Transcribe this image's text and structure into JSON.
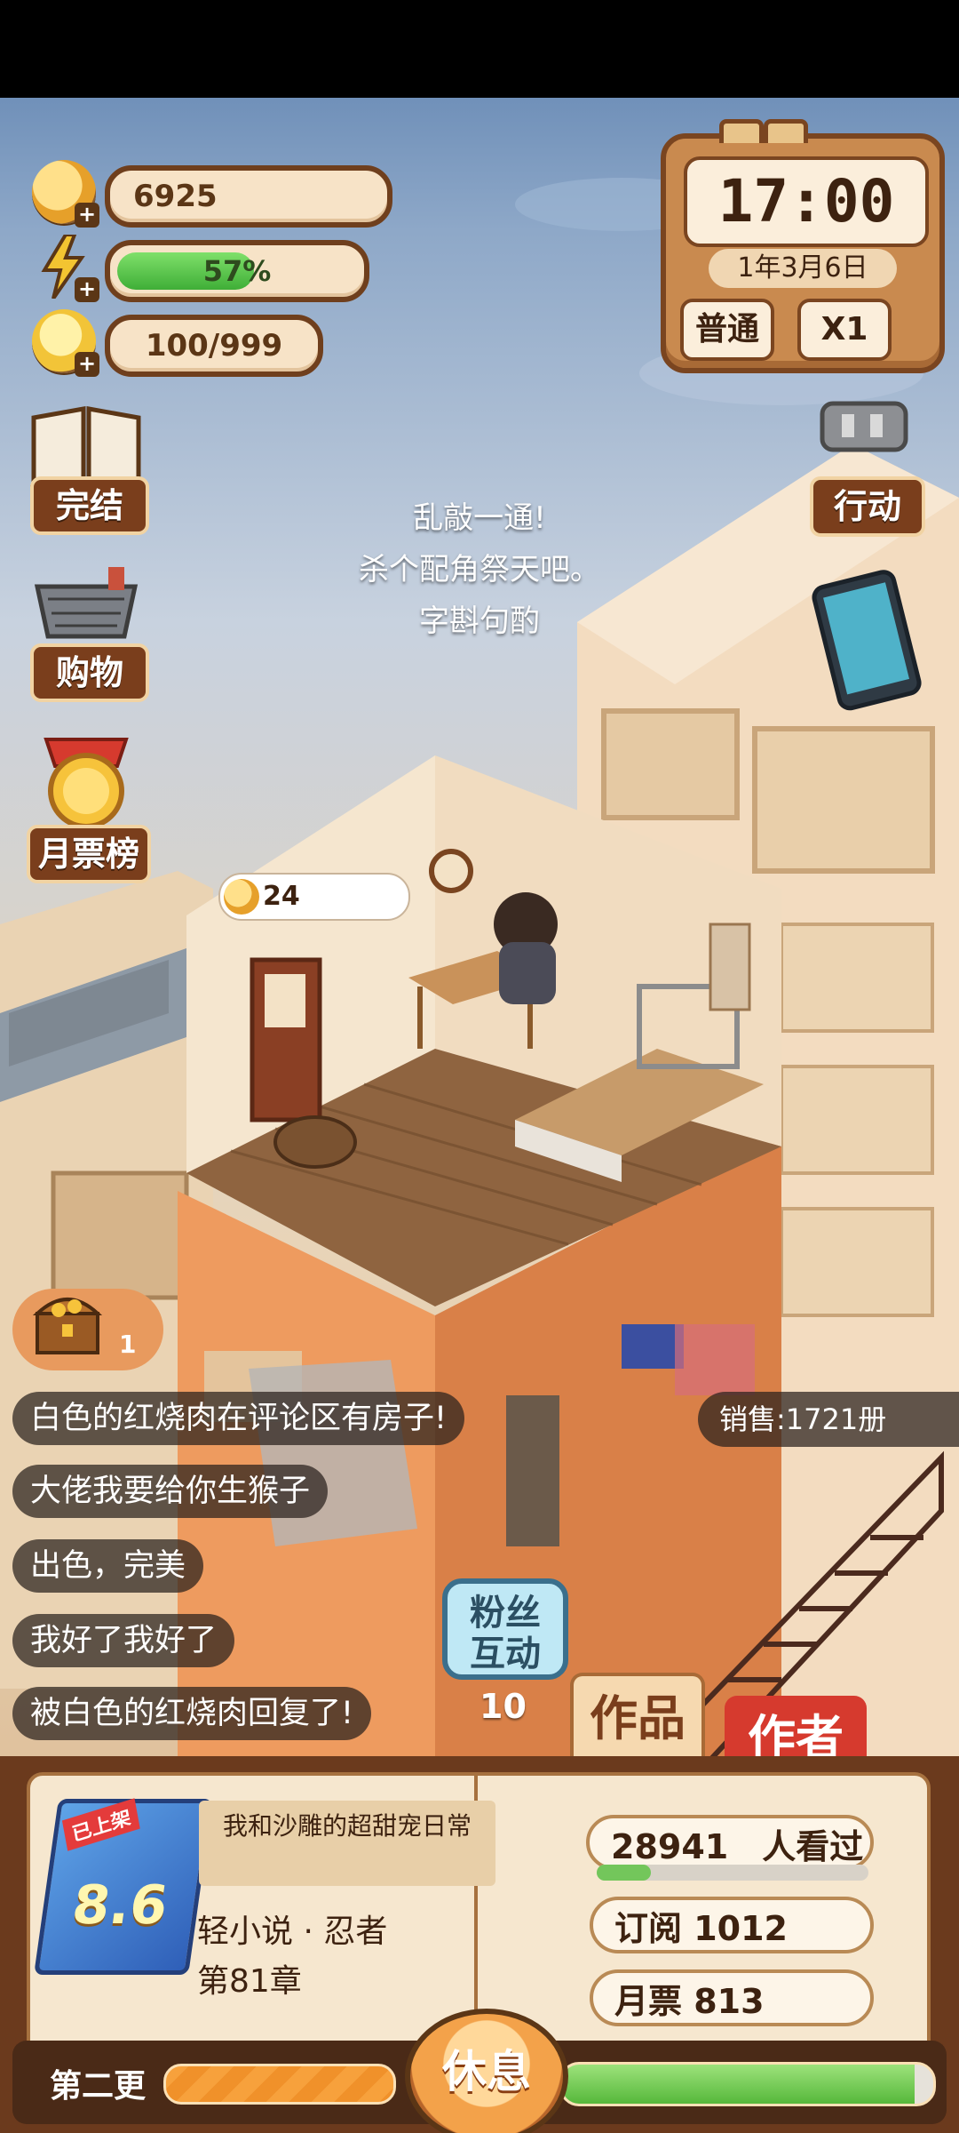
{
  "resources": {
    "coins": "6925",
    "energy_text": "57%",
    "energy_fraction": 0.57,
    "inspiration": "100/999"
  },
  "clock": {
    "time": "17:00",
    "date": "1年3月6日",
    "mode": "普通",
    "speed": "X1"
  },
  "side_menu": {
    "finish": "完结",
    "shop": "购物",
    "monthly_rank": "月票榜"
  },
  "right_menu": {
    "action": "行动"
  },
  "floating_text": [
    "乱敲一通!",
    "杀个配角祭天吧。",
    "字斟句酌"
  ],
  "room": {
    "coin_bubble": "24"
  },
  "treasure": {
    "count": "1"
  },
  "chat_messages": [
    "白色的红烧肉在评论区有房子!",
    "大佬我要给你生猴子",
    "出色，完美",
    "我好了我好了",
    "被白色的红烧肉回复了!"
  ],
  "sales": "销售:1721册",
  "fan": {
    "label_line1": "粉丝",
    "label_line2": "互动",
    "count": "10"
  },
  "tabs": {
    "works": "作品",
    "author": "作者"
  },
  "book": {
    "status_tag": "已上架",
    "score": "8.6",
    "title": "我和沙雕的超甜宠日常",
    "genre": "轻小说 · 忍者",
    "chapter": "第81章"
  },
  "stats": {
    "views": "28941　人看过",
    "views_fraction": 0.2,
    "subscriptions": "订阅 1012",
    "monthly_tickets": "月票 813"
  },
  "bottom": {
    "update_label": "第二更",
    "update_fraction": 0.75,
    "rest_button": "休息",
    "progress_fraction": 0.95
  },
  "colors": {
    "accent_brown": "#6f3f1d",
    "energy_green": "#3fae37",
    "author_tab_red": "#d63a2e"
  }
}
